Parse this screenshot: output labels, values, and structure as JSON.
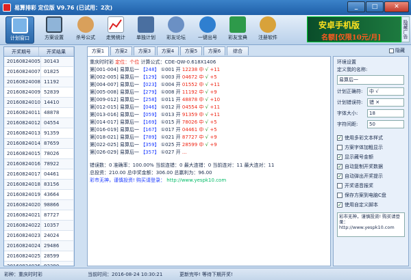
{
  "window": {
    "title": "易算排彩 定位版 V9.76 (已试用：2次)",
    "min": "_",
    "max": "□",
    "close": "✕"
  },
  "toolbar": {
    "items": [
      {
        "label": "计划窗口",
        "icon": "monitor-icon",
        "color": "#7ab4e8"
      },
      {
        "label": "方案设置",
        "icon": "screen-icon",
        "color": "#8fb4d8"
      },
      {
        "label": "杀号公式",
        "icon": "people-icon",
        "color": "#d9a05b"
      },
      {
        "label": "走势统计",
        "icon": "trend-icon",
        "color": "#ffffff"
      },
      {
        "label": "单独计划",
        "icon": "calc-icon",
        "color": "#4a6fa0"
      },
      {
        "label": "彩友论坛",
        "icon": "chat-icon",
        "color": "#6b90c4"
      },
      {
        "label": "一键出号",
        "icon": "globe-icon",
        "color": "#2f7fd0"
      },
      {
        "label": "彩友宝典",
        "icon": "book-icon",
        "color": "#2e9a4a"
      },
      {
        "label": "注册软件",
        "icon": "key-icon",
        "color": "#d8a23a"
      }
    ],
    "banner_line1": "安卓手机版",
    "banner_line2": "名额[仅限10元/月]",
    "side_label": "隐藏广告"
  },
  "history": {
    "headers": [
      "开奖期号",
      "开奖结果"
    ],
    "rows": [
      [
        "20160824005",
        "30143"
      ],
      [
        "20160824007",
        "01825"
      ],
      [
        "20160824008",
        "11192"
      ],
      [
        "20160824009",
        "52839"
      ],
      [
        "20160824010",
        "14410"
      ],
      [
        "20160824011",
        "48878"
      ],
      [
        "20160824012",
        "04554"
      ],
      [
        "20160824013",
        "91359"
      ],
      [
        "20160824014",
        "87659"
      ],
      [
        "20160824015",
        "78026"
      ],
      [
        "20160824016",
        "78922"
      ],
      [
        "20160824017",
        "04461"
      ],
      [
        "20160824018",
        "83156"
      ],
      [
        "20160824019",
        "43664"
      ],
      [
        "20160824020",
        "98866"
      ],
      [
        "20160824021",
        "87727"
      ],
      [
        "20160824022",
        "10357"
      ],
      [
        "20160824023",
        "24024"
      ],
      [
        "20160824024",
        "29486"
      ],
      [
        "20160824025",
        "28599"
      ],
      [
        "20160824026",
        "92390"
      ],
      [
        "20160824027",
        ""
      ]
    ]
  },
  "tabs": [
    "方案1",
    "方案2",
    "方案3",
    "方案4",
    "方案5",
    "方案6",
    "综合"
  ],
  "hide_label": "隐藏",
  "plan": {
    "header_a": "重庆时时彩",
    "header_b": "定位：个位",
    "header_c": "计算公式：CDE-QW-0.618X1406",
    "lines": [
      {
        "a": "第[001-004]",
        "b": "易算后一",
        "c": "【248】",
        "d": "①001",
        "e": "开",
        "f": "12238",
        "g": "中",
        "h": "√",
        "i": "+11"
      },
      {
        "a": "第[002-005]",
        "b": "易算后一",
        "c": "【129】",
        "d": "①003",
        "e": "开",
        "f": "04672",
        "g": "中",
        "h": "√",
        "i": "+5"
      },
      {
        "a": "第[004-007]",
        "b": "易算后一",
        "c": "【023】",
        "d": "①004",
        "e": "开",
        "f": "01552",
        "g": "中",
        "h": "√",
        "i": "+11"
      },
      {
        "a": "第[005-008]",
        "b": "易算后一",
        "c": "【279】",
        "d": "①008",
        "e": "开",
        "f": "11192",
        "g": "中",
        "h": "√",
        "i": "+9"
      },
      {
        "a": "第[009-012]",
        "b": "易算后一",
        "c": "【258】",
        "d": "①011",
        "e": "开",
        "f": "48878",
        "g": "中",
        "h": "√",
        "i": "+10"
      },
      {
        "a": "第[012-015]",
        "b": "易算后一",
        "c": "【046】",
        "d": "①012",
        "e": "开",
        "f": "04554",
        "g": "中",
        "h": "√",
        "i": "+11"
      },
      {
        "a": "第[013-016]",
        "b": "易算后一",
        "c": "【059】",
        "d": "①013",
        "e": "开",
        "f": "91359",
        "g": "中",
        "h": "√",
        "i": "+11"
      },
      {
        "a": "第[014-017]",
        "b": "易算后一",
        "c": "【169】",
        "d": "①015",
        "e": "开",
        "f": "78026",
        "g": "中",
        "h": "√",
        "i": "+5"
      },
      {
        "a": "第[016-019]",
        "b": "易算后一",
        "c": "【167】",
        "d": "①017",
        "e": "开",
        "f": "04461",
        "g": "中",
        "h": "√",
        "i": "+5"
      },
      {
        "a": "第[018-021]",
        "b": "易算后一",
        "c": "【789】",
        "d": "①021",
        "e": "开",
        "f": "87727",
        "g": "中",
        "h": "√",
        "i": "+9"
      },
      {
        "a": "第[022-025]",
        "b": "易算后一",
        "c": "【359】",
        "d": "①025",
        "e": "开",
        "f": "28599",
        "g": "中",
        "h": "√",
        "i": "+9"
      },
      {
        "a": "第[026-029]",
        "b": "易算后一",
        "c": "【357】",
        "d": "①027",
        "e": "开",
        "f": "...",
        "g": "",
        "h": "",
        "i": ""
      }
    ],
    "stats1": "错误数：0  准确率：100.00%  当前连错：0  最大连错：0  当前连对：11  最大连对：11",
    "stats2": "总投资：210.00  总中奖金额：306.00  总赢利为：96.00",
    "stats3a": "彩市无神，谨慎投资! 购买请登录：",
    "stats3b": "http://www.yespk10.com"
  },
  "settings": {
    "title": "环境设置",
    "name_label": "定义我的名称:",
    "name_value": "易算后一",
    "rows": [
      {
        "k": "计划正确符:",
        "v": "中 √"
      },
      {
        "k": "计划错误符:",
        "v": "错 ✕"
      },
      {
        "k": "字体大小:",
        "v": "18"
      },
      {
        "k": "字符间距:",
        "v": "50"
      }
    ],
    "checks": [
      {
        "label": "使用多彩文本样式",
        "on": "✓"
      },
      {
        "label": "方案字体加粗显示",
        "on": ""
      },
      {
        "label": "显示藏号金额",
        "on": "✓"
      },
      {
        "label": "自动复制开奖数据",
        "on": "✓"
      },
      {
        "label": "自动弹出开奖提示",
        "on": "✓"
      },
      {
        "label": "开奖语音报奖",
        "on": ""
      },
      {
        "label": "保存方案到电脑C盘",
        "on": ""
      },
      {
        "label": "使用自定义脚本",
        "on": "✓"
      }
    ],
    "notes": "彩市无神，谨慎投资! 购买请登录：http://www.yespk10.com"
  },
  "status": {
    "s1": "彩种：重庆时时彩",
    "s2": "当前时间：2016-08-24 10:30:21",
    "s3": "更新完毕! 等待下期开奖!"
  }
}
